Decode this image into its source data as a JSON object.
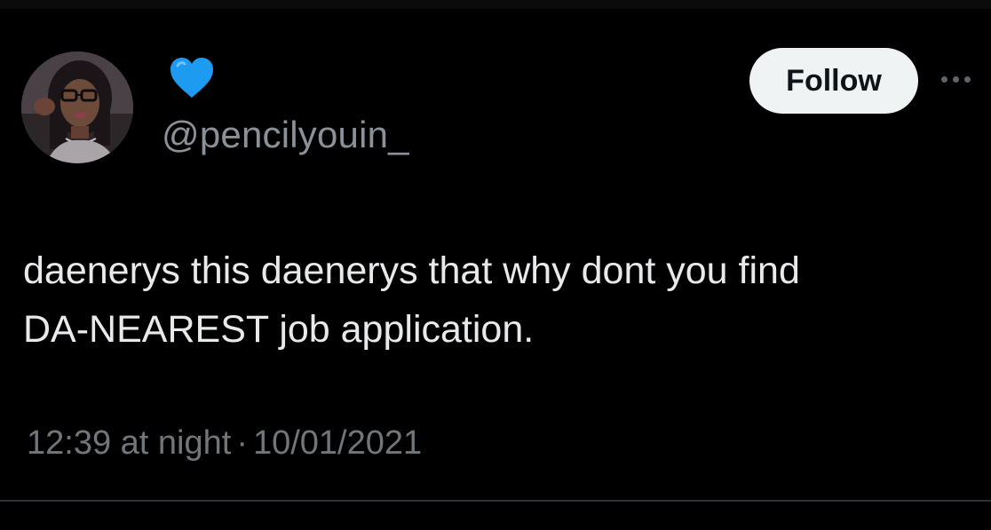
{
  "tweet": {
    "display_name_icon": "blue-heart-icon",
    "handle": "@pencilyouin_",
    "follow_label": "Follow",
    "more_icon": "more-icon",
    "text_line1": "daenerys this daenerys that why dont you find",
    "text_line2": "DA-NEAREST job application.",
    "time": "12:39 at night",
    "separator": "·",
    "date": "10/01/2021"
  },
  "colors": {
    "background": "#000000",
    "text": "#e7e9ea",
    "muted": "#71767b",
    "follow_bg": "#eff3f4",
    "heart": "#1d9bf0"
  }
}
